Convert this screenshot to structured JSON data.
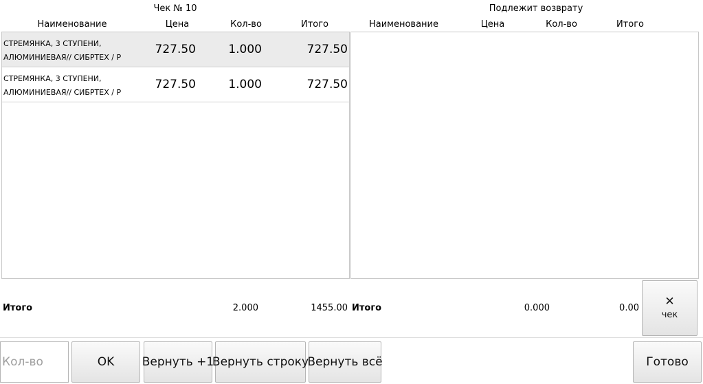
{
  "receipt": {
    "title": "Чек № 10",
    "headers": {
      "name": "Наименование",
      "price": "Цена",
      "qty": "Кол-во",
      "total": "Итого"
    },
    "rows": [
      {
        "name_line1": "СТРЕМЯНКА, 3 СТУПЕНИ,",
        "name_line2": "АЛЮМИНИЕВАЯ// СИБРТЕХ / Р",
        "price": "727.50",
        "qty": "1.000",
        "total": "727.50",
        "selected": true
      },
      {
        "name_line1": "СТРЕМЯНКА, 3 СТУПЕНИ,",
        "name_line2": "АЛЮМИНИЕВАЯ// СИБРТЕХ / Р",
        "price": "727.50",
        "qty": "1.000",
        "total": "727.50",
        "selected": false
      }
    ],
    "footer": {
      "label": "Итого",
      "qty": "2.000",
      "total": "1455.00"
    }
  },
  "returns": {
    "title": "Подлежит возврату",
    "headers": {
      "name": "Наименование",
      "price": "Цена",
      "qty": "Кол-во",
      "total": "Итого"
    },
    "rows": [],
    "footer": {
      "label": "Итого",
      "qty": "0.000",
      "total": "0.00"
    }
  },
  "close_button": {
    "icon": "close-icon",
    "label": "чек"
  },
  "toolbar": {
    "qty_placeholder": "Кол-во",
    "ok_label": "OK",
    "return_one_label": "Вернуть +1",
    "return_line_label": "Вернуть строку",
    "return_all_label": "Вернуть всё",
    "done_label": "Готово"
  }
}
